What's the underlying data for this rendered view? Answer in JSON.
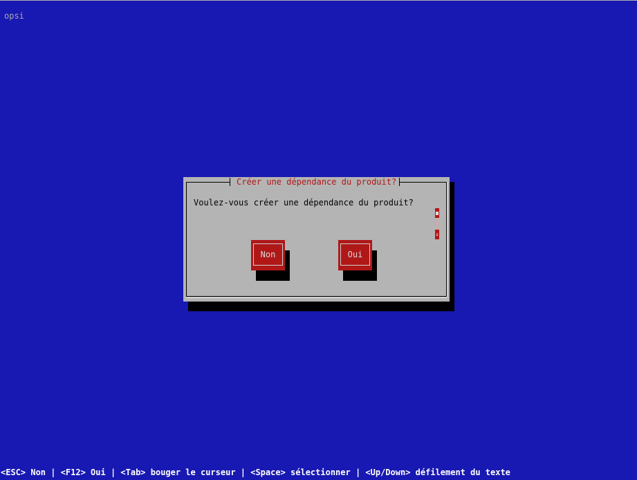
{
  "app": {
    "title": "opsi"
  },
  "dialog": {
    "title": "Créer une dépendance du produit?",
    "message": "Voulez-vous créer une dépendance du produit?",
    "buttons": {
      "no_label": "Non",
      "yes_label": "Oui"
    },
    "scrollbar": {
      "down_arrow": "↓"
    }
  },
  "status_bar": {
    "text": "<ESC> Non | <F12> Oui | <Tab> bouger le curseur | <Space> sélectionner | <Up/Down> défilement du texte"
  },
  "colors": {
    "background": "#1818b2",
    "dialog": "#b4b4b4",
    "accent": "#b01818",
    "shadow": "#000000"
  }
}
